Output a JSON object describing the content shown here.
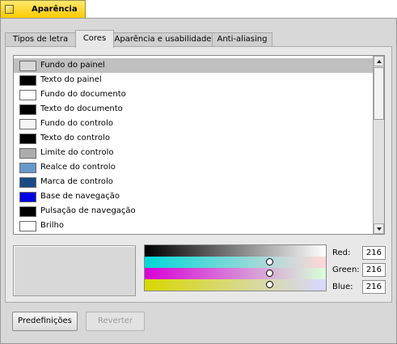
{
  "window": {
    "title": "Aparência"
  },
  "tabs": [
    {
      "label": "Tipos de letra",
      "active": false
    },
    {
      "label": "Cores",
      "active": true
    },
    {
      "label": "Aparência e usabilidade",
      "active": false
    },
    {
      "label": "Anti-aliasing",
      "active": false
    }
  ],
  "color_list": {
    "selected_index": 0,
    "items": [
      {
        "label": "Fundo do painel",
        "color": "#d8d8d8"
      },
      {
        "label": "Texto do painel",
        "color": "#000000"
      },
      {
        "label": "Fundo do documento",
        "color": "#ffffff"
      },
      {
        "label": "Texto do documento",
        "color": "#000000"
      },
      {
        "label": "Fundo do controlo",
        "color": "#f5f5f5"
      },
      {
        "label": "Texto do controlo",
        "color": "#000000"
      },
      {
        "label": "Limite do controlo",
        "color": "#acacac"
      },
      {
        "label": "Realce do controlo",
        "color": "#6698cb"
      },
      {
        "label": "Marca de controlo",
        "color": "#1a4a84"
      },
      {
        "label": "Base de navegação",
        "color": "#0000e5"
      },
      {
        "label": "Pulsação de navegação",
        "color": "#000000"
      },
      {
        "label": "Brilho",
        "color": "#ffffff"
      },
      {
        "label": "",
        "color": "#000000"
      }
    ]
  },
  "color_picker": {
    "preview_color": "#d8d8d8",
    "red_label": "Red:",
    "green_label": "Green:",
    "blue_label": "Blue:",
    "red": "216",
    "green": "216",
    "blue": "216"
  },
  "buttons": {
    "defaults_label": "Predefinições",
    "revert_label": "Reverter",
    "revert_enabled": false
  }
}
